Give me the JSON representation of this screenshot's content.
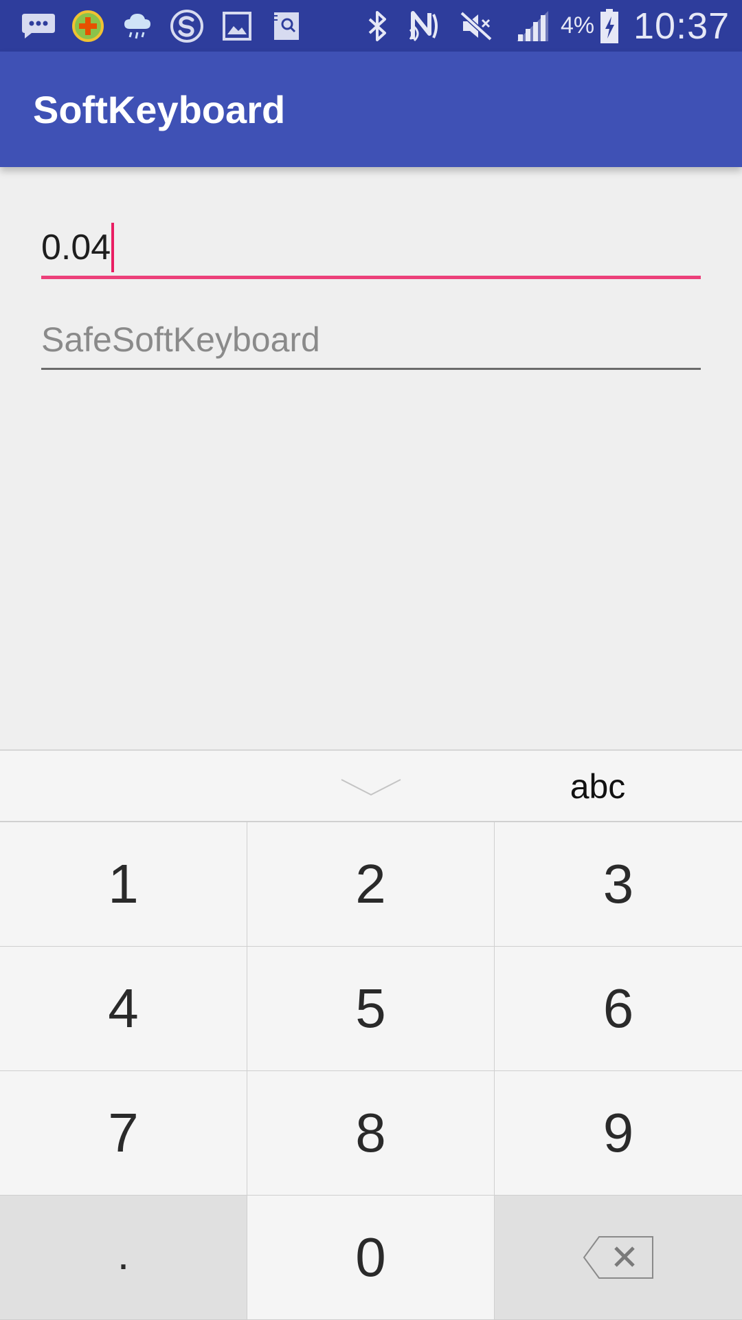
{
  "status_bar": {
    "icons": [
      "message-icon",
      "game-icon",
      "weather-icon",
      "sogou-icon",
      "gallery-icon",
      "file-search-icon",
      "bluetooth-icon",
      "nfc-icon",
      "mute-icon",
      "signal-icon",
      "battery-charging-icon"
    ],
    "battery_percent": "4%",
    "time": "10:37",
    "background_color": "#2e3d9c"
  },
  "app_bar": {
    "title": "SoftKeyboard",
    "background_color": "#3f51b5"
  },
  "form": {
    "amount_field": {
      "value": "0.04",
      "accent_color": "#ec407a"
    },
    "safe_keyboard_field": {
      "placeholder": "SafeSoftKeyboard"
    }
  },
  "keyboard": {
    "collapse_icon": "chevron-down-icon",
    "mode_switch_label": "abc",
    "keys": [
      {
        "label": "1"
      },
      {
        "label": "2"
      },
      {
        "label": "3"
      },
      {
        "label": "4"
      },
      {
        "label": "5"
      },
      {
        "label": "6"
      },
      {
        "label": "7"
      },
      {
        "label": "8"
      },
      {
        "label": "9"
      },
      {
        "label": "."
      },
      {
        "label": "0"
      },
      {
        "label": "",
        "icon": "backspace-icon"
      }
    ]
  }
}
